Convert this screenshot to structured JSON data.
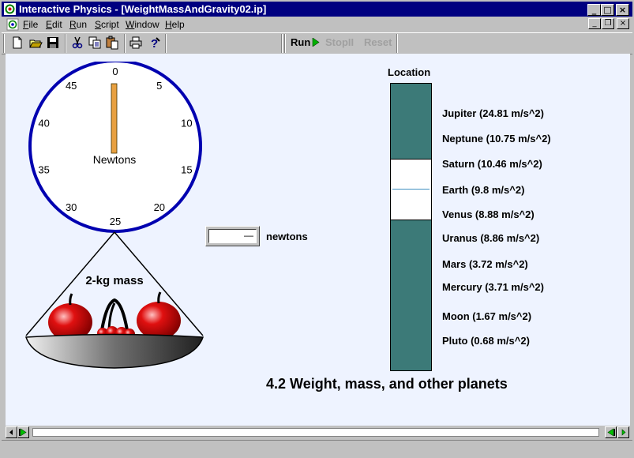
{
  "window": {
    "title": "Interactive Physics - [WeightMassAndGravity02.ip]",
    "caption_buttons": {
      "minimize": "_",
      "maximize": "□",
      "close": "×"
    },
    "mdi_buttons": {
      "minimize": "_",
      "restore": "❐",
      "close": "×"
    }
  },
  "menu": {
    "items": [
      {
        "key": "F",
        "rest": "ile"
      },
      {
        "key": "E",
        "rest": "dit"
      },
      {
        "key": "R",
        "rest": "un"
      },
      {
        "key": "S",
        "rest": "cript"
      },
      {
        "key": "W",
        "rest": "indow"
      },
      {
        "key": "H",
        "rest": "elp"
      }
    ]
  },
  "toolbar": {
    "icons": [
      "new-file-icon",
      "open-folder-icon",
      "save-disk-icon",
      "cut-scissors-icon",
      "copy-icon",
      "paste-icon",
      "print-icon",
      "help-icon"
    ],
    "run_label": "Run",
    "stop_label": "StopII",
    "reset_label": "Reset"
  },
  "dial": {
    "ticks": [
      "0",
      "5",
      "10",
      "15",
      "20",
      "25",
      "30",
      "35",
      "40",
      "45"
    ],
    "unit_label": "Newtons",
    "reading": 0
  },
  "scale": {
    "mass_label": "2-kg mass"
  },
  "meter": {
    "unit": "newtons",
    "value": "—"
  },
  "location": {
    "title": "Location",
    "selected": "Earth (9.8 m/s^2)",
    "planets": [
      "Jupiter (24.81 m/s^2)",
      "Neptune (10.75 m/s^2)",
      "Saturn (10.46 m/s^2)",
      "Earth (9.8 m/s^2)",
      "Venus (8.88 m/s^2)",
      "Uranus (8.86 m/s^2)",
      "Mars (3.72 m/s^2)",
      "Mercury (3.71 m/s^2)",
      "Moon (1.67 m/s^2)",
      "Pluto (0.68 m/s^2)"
    ]
  },
  "heading": "4.2 Weight, mass, and other planets",
  "colors": {
    "titlebar": "#000080",
    "workspace": "#eef3ff",
    "dial_rim": "#0000b0",
    "needle": "#e8a040",
    "slider_track": "#3c7a78",
    "apple": "#d81010",
    "run_green": "#00b000"
  }
}
